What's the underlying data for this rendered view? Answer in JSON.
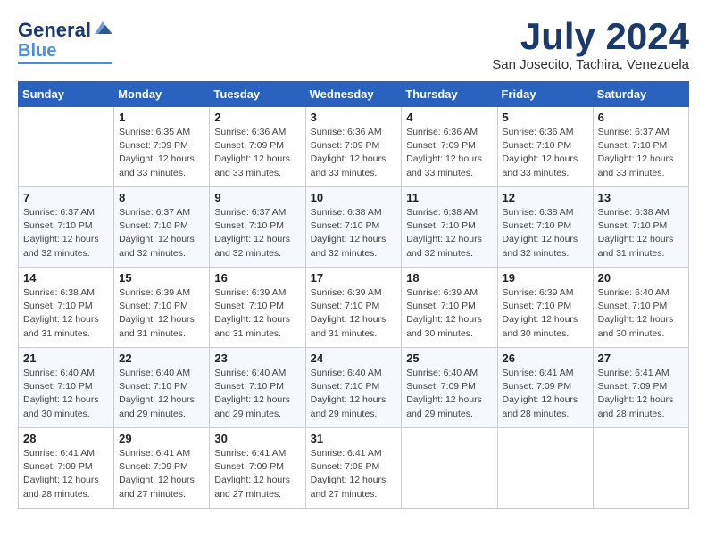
{
  "logo": {
    "part1": "General",
    "part2": "Blue"
  },
  "title": "July 2024",
  "location": "San Josecito, Tachira, Venezuela",
  "headers": [
    "Sunday",
    "Monday",
    "Tuesday",
    "Wednesday",
    "Thursday",
    "Friday",
    "Saturday"
  ],
  "weeks": [
    [
      {
        "day": "",
        "info": ""
      },
      {
        "day": "1",
        "info": "Sunrise: 6:35 AM\nSunset: 7:09 PM\nDaylight: 12 hours\nand 33 minutes."
      },
      {
        "day": "2",
        "info": "Sunrise: 6:36 AM\nSunset: 7:09 PM\nDaylight: 12 hours\nand 33 minutes."
      },
      {
        "day": "3",
        "info": "Sunrise: 6:36 AM\nSunset: 7:09 PM\nDaylight: 12 hours\nand 33 minutes."
      },
      {
        "day": "4",
        "info": "Sunrise: 6:36 AM\nSunset: 7:09 PM\nDaylight: 12 hours\nand 33 minutes."
      },
      {
        "day": "5",
        "info": "Sunrise: 6:36 AM\nSunset: 7:10 PM\nDaylight: 12 hours\nand 33 minutes."
      },
      {
        "day": "6",
        "info": "Sunrise: 6:37 AM\nSunset: 7:10 PM\nDaylight: 12 hours\nand 33 minutes."
      }
    ],
    [
      {
        "day": "7",
        "info": "Sunrise: 6:37 AM\nSunset: 7:10 PM\nDaylight: 12 hours\nand 32 minutes."
      },
      {
        "day": "8",
        "info": "Sunrise: 6:37 AM\nSunset: 7:10 PM\nDaylight: 12 hours\nand 32 minutes."
      },
      {
        "day": "9",
        "info": "Sunrise: 6:37 AM\nSunset: 7:10 PM\nDaylight: 12 hours\nand 32 minutes."
      },
      {
        "day": "10",
        "info": "Sunrise: 6:38 AM\nSunset: 7:10 PM\nDaylight: 12 hours\nand 32 minutes."
      },
      {
        "day": "11",
        "info": "Sunrise: 6:38 AM\nSunset: 7:10 PM\nDaylight: 12 hours\nand 32 minutes."
      },
      {
        "day": "12",
        "info": "Sunrise: 6:38 AM\nSunset: 7:10 PM\nDaylight: 12 hours\nand 32 minutes."
      },
      {
        "day": "13",
        "info": "Sunrise: 6:38 AM\nSunset: 7:10 PM\nDaylight: 12 hours\nand 31 minutes."
      }
    ],
    [
      {
        "day": "14",
        "info": "Sunrise: 6:38 AM\nSunset: 7:10 PM\nDaylight: 12 hours\nand 31 minutes."
      },
      {
        "day": "15",
        "info": "Sunrise: 6:39 AM\nSunset: 7:10 PM\nDaylight: 12 hours\nand 31 minutes."
      },
      {
        "day": "16",
        "info": "Sunrise: 6:39 AM\nSunset: 7:10 PM\nDaylight: 12 hours\nand 31 minutes."
      },
      {
        "day": "17",
        "info": "Sunrise: 6:39 AM\nSunset: 7:10 PM\nDaylight: 12 hours\nand 31 minutes."
      },
      {
        "day": "18",
        "info": "Sunrise: 6:39 AM\nSunset: 7:10 PM\nDaylight: 12 hours\nand 30 minutes."
      },
      {
        "day": "19",
        "info": "Sunrise: 6:39 AM\nSunset: 7:10 PM\nDaylight: 12 hours\nand 30 minutes."
      },
      {
        "day": "20",
        "info": "Sunrise: 6:40 AM\nSunset: 7:10 PM\nDaylight: 12 hours\nand 30 minutes."
      }
    ],
    [
      {
        "day": "21",
        "info": "Sunrise: 6:40 AM\nSunset: 7:10 PM\nDaylight: 12 hours\nand 30 minutes."
      },
      {
        "day": "22",
        "info": "Sunrise: 6:40 AM\nSunset: 7:10 PM\nDaylight: 12 hours\nand 29 minutes."
      },
      {
        "day": "23",
        "info": "Sunrise: 6:40 AM\nSunset: 7:10 PM\nDaylight: 12 hours\nand 29 minutes."
      },
      {
        "day": "24",
        "info": "Sunrise: 6:40 AM\nSunset: 7:10 PM\nDaylight: 12 hours\nand 29 minutes."
      },
      {
        "day": "25",
        "info": "Sunrise: 6:40 AM\nSunset: 7:09 PM\nDaylight: 12 hours\nand 29 minutes."
      },
      {
        "day": "26",
        "info": "Sunrise: 6:41 AM\nSunset: 7:09 PM\nDaylight: 12 hours\nand 28 minutes."
      },
      {
        "day": "27",
        "info": "Sunrise: 6:41 AM\nSunset: 7:09 PM\nDaylight: 12 hours\nand 28 minutes."
      }
    ],
    [
      {
        "day": "28",
        "info": "Sunrise: 6:41 AM\nSunset: 7:09 PM\nDaylight: 12 hours\nand 28 minutes."
      },
      {
        "day": "29",
        "info": "Sunrise: 6:41 AM\nSunset: 7:09 PM\nDaylight: 12 hours\nand 27 minutes."
      },
      {
        "day": "30",
        "info": "Sunrise: 6:41 AM\nSunset: 7:09 PM\nDaylight: 12 hours\nand 27 minutes."
      },
      {
        "day": "31",
        "info": "Sunrise: 6:41 AM\nSunset: 7:08 PM\nDaylight: 12 hours\nand 27 minutes."
      },
      {
        "day": "",
        "info": ""
      },
      {
        "day": "",
        "info": ""
      },
      {
        "day": "",
        "info": ""
      }
    ]
  ]
}
